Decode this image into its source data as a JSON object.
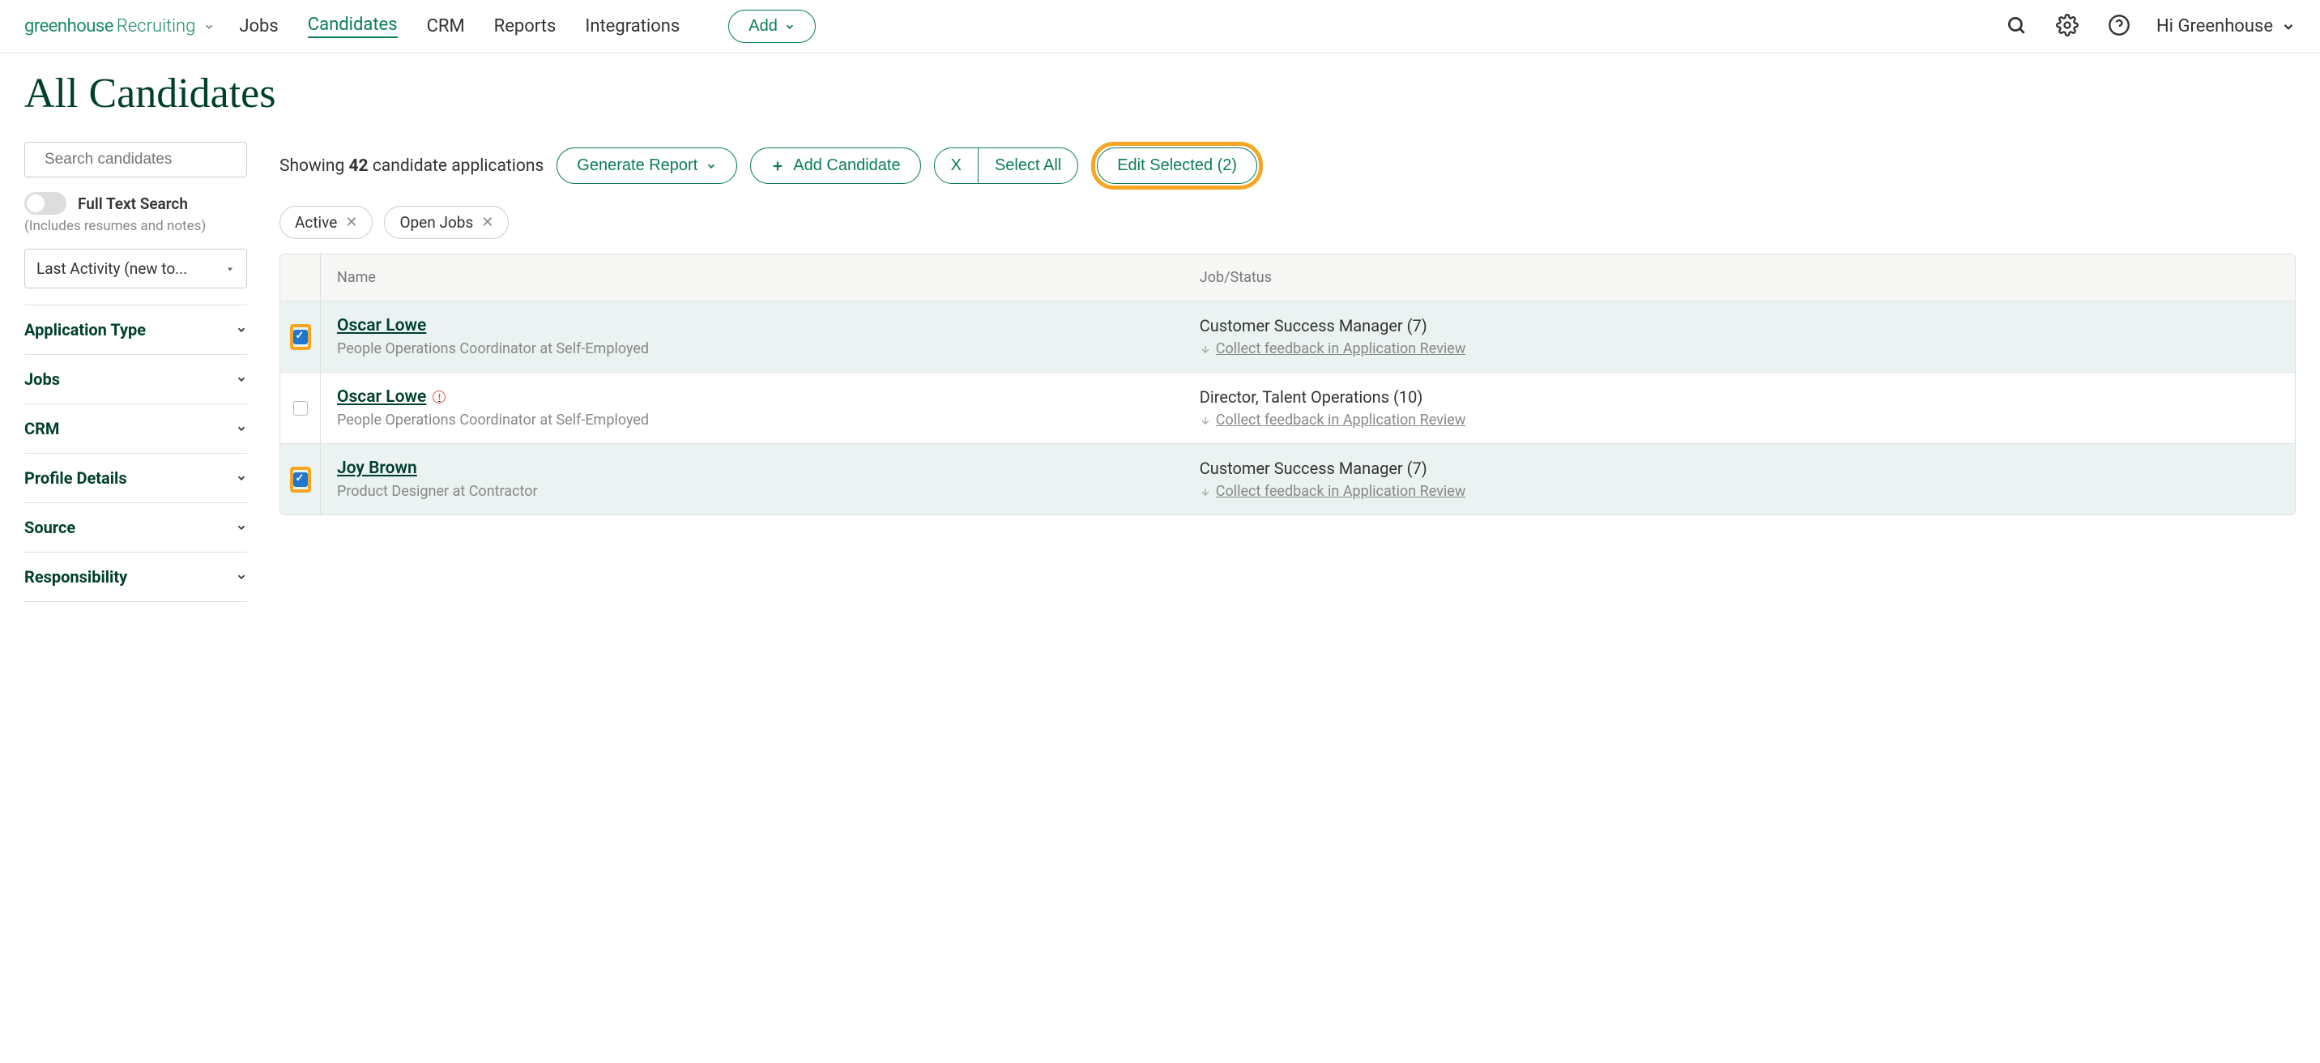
{
  "header": {
    "logo_main": "greenhouse",
    "logo_sub": "Recruiting",
    "nav": [
      "Jobs",
      "Candidates",
      "CRM",
      "Reports",
      "Integrations"
    ],
    "active_nav": "Candidates",
    "add_label": "Add",
    "greeting": "Hi Greenhouse"
  },
  "page_title": "All Candidates",
  "sidebar": {
    "search_placeholder": "Search candidates",
    "full_text_label": "Full Text Search",
    "full_text_hint": "(Includes resumes and notes)",
    "sort_label": "Last Activity (new to...",
    "filters": [
      "Application Type",
      "Jobs",
      "CRM",
      "Profile Details",
      "Source",
      "Responsibility"
    ]
  },
  "toolbar": {
    "showing_prefix": "Showing ",
    "count": "42",
    "showing_suffix": " candidate applications",
    "generate_report": "Generate Report",
    "add_candidate": "Add Candidate",
    "clear_x": "X",
    "select_all": "Select All",
    "edit_selected": "Edit Selected (2)"
  },
  "chips": [
    {
      "label": "Active"
    },
    {
      "label": "Open Jobs"
    }
  ],
  "table": {
    "headers": {
      "name": "Name",
      "job": "Job/Status"
    },
    "rows": [
      {
        "selected": true,
        "highlight_cb": true,
        "name": "Oscar Lowe",
        "warn": false,
        "sub": "People Operations Coordinator at Self-Employed",
        "job": "Customer Success Manager (7)",
        "status": "Collect feedback in Application Review"
      },
      {
        "selected": false,
        "highlight_cb": false,
        "name": "Oscar Lowe",
        "warn": true,
        "sub": "People Operations Coordinator at Self-Employed",
        "job": "Director, Talent Operations (10)",
        "status": "Collect feedback in Application Review"
      },
      {
        "selected": true,
        "highlight_cb": true,
        "name": "Joy Brown",
        "warn": false,
        "sub": "Product Designer at Contractor",
        "job": "Customer Success Manager (7)",
        "status": "Collect feedback in Application Review"
      }
    ]
  }
}
